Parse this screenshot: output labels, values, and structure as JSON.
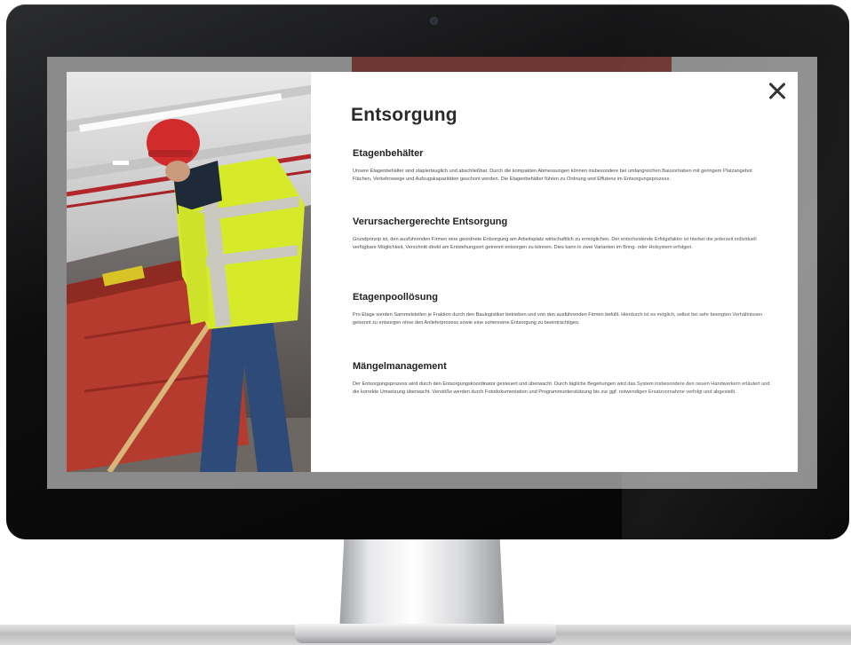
{
  "modal": {
    "title": "Entsorgung",
    "close_icon": "close-icon",
    "sections": [
      {
        "heading": "Etagenbehälter",
        "body": "Unsere Etagenbehälter sind staplertauglich und abschließbar. Durch die kompakten Abmessungen können insbesondere bei umfangreichen Bauvorhaben mit geringem Platzangebot Flächen, Verkehrswege und Aufzugskapazitäten geschont werden. Die Etagenbehälter führen zu Ordnung und Effizienz im Entsorgungsprozess."
      },
      {
        "heading": "Verursachergerechte Entsorgung",
        "body": "Grundprinzip ist, den ausführenden Firmen eine geordnete Entsorgung am Arbeitsplatz wirtschaftlich zu ermöglichen. Der entscheidende Erfolgsfaktor ist hierbei die jederzeit individuell verfügbare Möglichkeit, Verschnitt direkt am Entstehungsort getrennt entsorgen zu können. Dies kann in zwei Varianten im Bring- oder Holsystem erfolgen."
      },
      {
        "heading": "Etagenpoollösung",
        "body": "Pro Etage werden Sammelstellen je Fraktion durch den Baulogistiker betrieben und von den ausführenden Firmen befüllt. Hierdurch ist es möglich, selbst bei sehr beengten Verhältnissen getrennt zu entsorgen ohne den Anlieferprozess sowie eine sortenreine Entsorgung zu beeinträchtigen."
      },
      {
        "heading": "Mängelmanagement",
        "body": "Der Entsorgungsprozess wird durch den Entsorgungskoordinator gesteuert und überwacht. Durch tägliche Begehungen wird das System insbesondere den neuen Handwerkern erläutert und die korrekte Umsetzung überwacht. Verstöße werden durch Fotodokumentation und Programmunterstützung bis zur ggf. notwendigen Ersatzvornahme verfolgt und abgestellt."
      }
    ]
  },
  "colors": {
    "accent_bar": "#6e3732",
    "overlay": "#8b8b8b",
    "helmet": "#d22b2b",
    "vest": "#d6ea2a",
    "container": "#b33a2e"
  }
}
